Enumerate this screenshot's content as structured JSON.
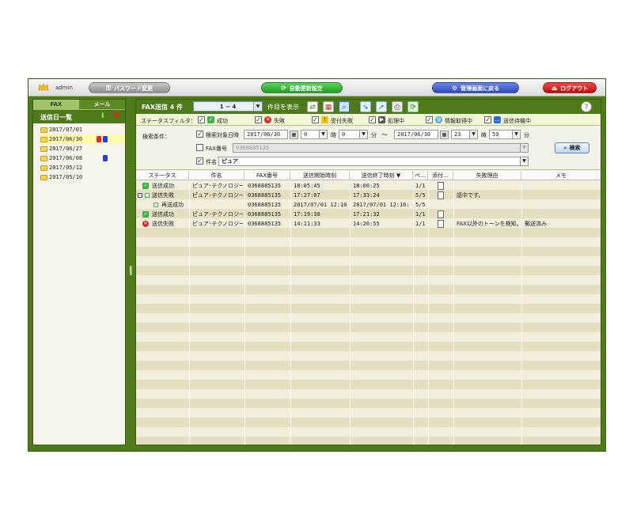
{
  "header": {
    "user": "admin",
    "password_button": "パスワード変更",
    "autorefresh_button": "自動更新設定",
    "admin_button": "管理画面に戻る",
    "logout_button": "ログアウト"
  },
  "sidebar": {
    "tabs": [
      {
        "label": "FAX"
      },
      {
        "label": "メール"
      }
    ],
    "title": "送信日一覧",
    "dates": [
      {
        "label": "2017/07/01"
      },
      {
        "label": "2017/06/30"
      },
      {
        "label": "2017/06/27"
      },
      {
        "label": "2017/06/08"
      },
      {
        "label": "2017/05/12"
      },
      {
        "label": "2017/05/10"
      }
    ]
  },
  "main": {
    "title": "FAX送信 4 件",
    "page_range": "1 ~ 4",
    "show_label": "件目を表示"
  },
  "filter": {
    "label": "ステータスフィルタ：",
    "items": [
      {
        "label": "成功"
      },
      {
        "label": "失敗"
      },
      {
        "label": "受付失敗"
      },
      {
        "label": "処理中"
      },
      {
        "label": "情報取得中"
      },
      {
        "label": "送信待機中"
      }
    ]
  },
  "search": {
    "cond_label": "検索条件：",
    "datetime_label": "検索対象日時",
    "from_date": "2017/06/30",
    "from_hour": "0",
    "from_min": "0",
    "to_date": "2017/06/30",
    "to_hour": "23",
    "to_min": "59",
    "hour_unit": "時",
    "min_unit": "分",
    "range_sep": "～",
    "fax_label": "FAX番号",
    "fax_value": "0368885135",
    "subject_label": "件名",
    "subject_value": "ピュア",
    "search_button": "検索"
  },
  "table": {
    "columns": [
      "ステータス",
      "件名",
      "FAX番号",
      "送信開始時刻",
      "送信終了時刻 ▼",
      "ペ…",
      "添付…",
      "失敗理由",
      "メモ"
    ],
    "rows": [
      {
        "status": "送信成功",
        "subject": "ピュア･テクノロジーズ",
        "fax": "0368885135",
        "start": "18:05:45",
        "end": "18:06:25",
        "pages": "1/1",
        "reason": "",
        "memo": ""
      },
      {
        "status": "送信失敗",
        "subject": "ピュア･テクノロジーズ",
        "fax": "0368885135",
        "start": "17:27:07",
        "end": "17:33:24",
        "pages": "5/5",
        "reason": "話中です。",
        "memo": ""
      },
      {
        "status": "再送成功",
        "subject": "",
        "fax": "0368885135",
        "start": "2017/07/01 12:10",
        "end": "2017/07/01 12:16:",
        "pages": "5/5",
        "reason": "",
        "memo": ""
      },
      {
        "status": "送信成功",
        "subject": "ピュア･テクノロジーズ",
        "fax": "0368885135",
        "start": "17:19:38",
        "end": "17:21:32",
        "pages": "1/1",
        "reason": "",
        "memo": ""
      },
      {
        "status": "送信失敗",
        "subject": "ピュア･テクノロジーズ",
        "fax": "0368885135",
        "start": "14:11:33",
        "end": "14:26:55",
        "pages": "1/1",
        "reason": "FAX以外のトーンを検知。",
        "memo": "郵送済み"
      }
    ]
  }
}
